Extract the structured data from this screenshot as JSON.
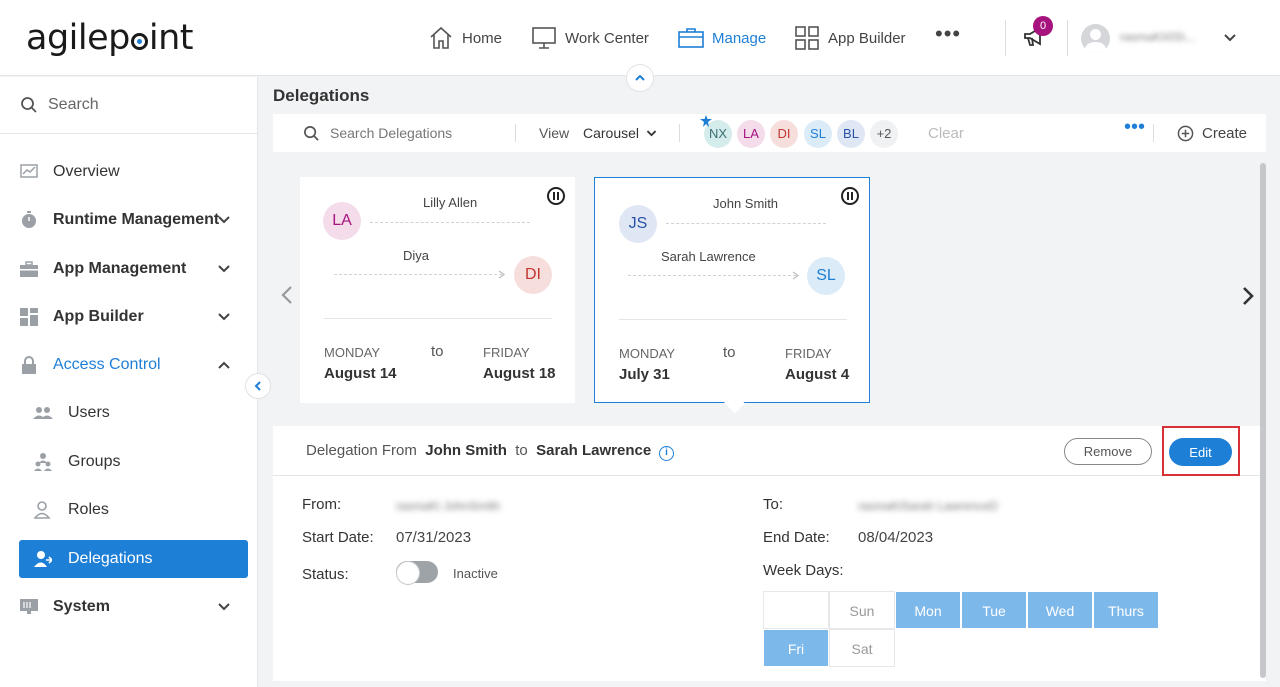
{
  "brand": {
    "logo_text_a": "agilep",
    "logo_text_b": "int"
  },
  "nav": {
    "home": "Home",
    "work_center": "Work Center",
    "manage": "Manage",
    "app_builder": "App Builder",
    "more": "•••",
    "notifications_count": "0",
    "username": "rasmaKi\\0S\\..."
  },
  "sidebar": {
    "search_placeholder": "Search",
    "items": [
      {
        "label": "Overview"
      },
      {
        "label": "Runtime Management"
      },
      {
        "label": "App Management"
      },
      {
        "label": "App Builder"
      },
      {
        "label": "Access Control"
      },
      {
        "label": "Users"
      },
      {
        "label": "Groups"
      },
      {
        "label": "Roles"
      },
      {
        "label": "Delegations"
      },
      {
        "label": "System"
      }
    ]
  },
  "page": {
    "title": "Delegations"
  },
  "toolbar": {
    "search_placeholder": "Search Delegations",
    "view_label": "View",
    "view_value": "Carousel",
    "chips": [
      "NX",
      "LA",
      "DI",
      "SL",
      "BL",
      "+2"
    ],
    "clear": "Clear",
    "more": "•••",
    "create": "Create"
  },
  "cards": [
    {
      "from_initials": "LA",
      "from_name": "Lilly Allen",
      "to_initials": "DI",
      "to_name": "Diya",
      "start_day": "MONDAY",
      "start_date": "August 14",
      "to_word": "to",
      "end_day": "FRIDAY",
      "end_date": "August 18"
    },
    {
      "from_initials": "JS",
      "from_name": "John Smith",
      "to_initials": "SL",
      "to_name": "Sarah Lawrence",
      "start_day": "MONDAY",
      "start_date": "July 31",
      "to_word": "to",
      "end_day": "FRIDAY",
      "end_date": "August 4"
    }
  ],
  "details": {
    "title_prefix": "Delegation From",
    "from_name": "John Smith",
    "title_mid": "to",
    "to_name": "Sarah Lawrence",
    "remove": "Remove",
    "edit": "Edit",
    "from_label": "From:",
    "from_value": "rasmaKi JohnSmith",
    "to_label": "To:",
    "to_value": "rasmaKiSarah LawrenceD",
    "start_label": "Start Date:",
    "start_value": "07/31/2023",
    "end_label": "End Date:",
    "end_value": "08/04/2023",
    "status_label": "Status:",
    "status_value": "Inactive",
    "weekdays_label": "Week Days:",
    "weekdays": [
      {
        "label": "",
        "selected": false
      },
      {
        "label": "Sun",
        "selected": false
      },
      {
        "label": "Mon",
        "selected": true
      },
      {
        "label": "Tue",
        "selected": true
      },
      {
        "label": "Wed",
        "selected": true
      },
      {
        "label": "Thurs",
        "selected": true
      },
      {
        "label": "Fri",
        "selected": true
      },
      {
        "label": "Sat",
        "selected": false
      }
    ]
  },
  "colors": {
    "accent": "#1e7fd6",
    "highlight_border": "#d93036",
    "day_selected": "#7db8ea"
  }
}
